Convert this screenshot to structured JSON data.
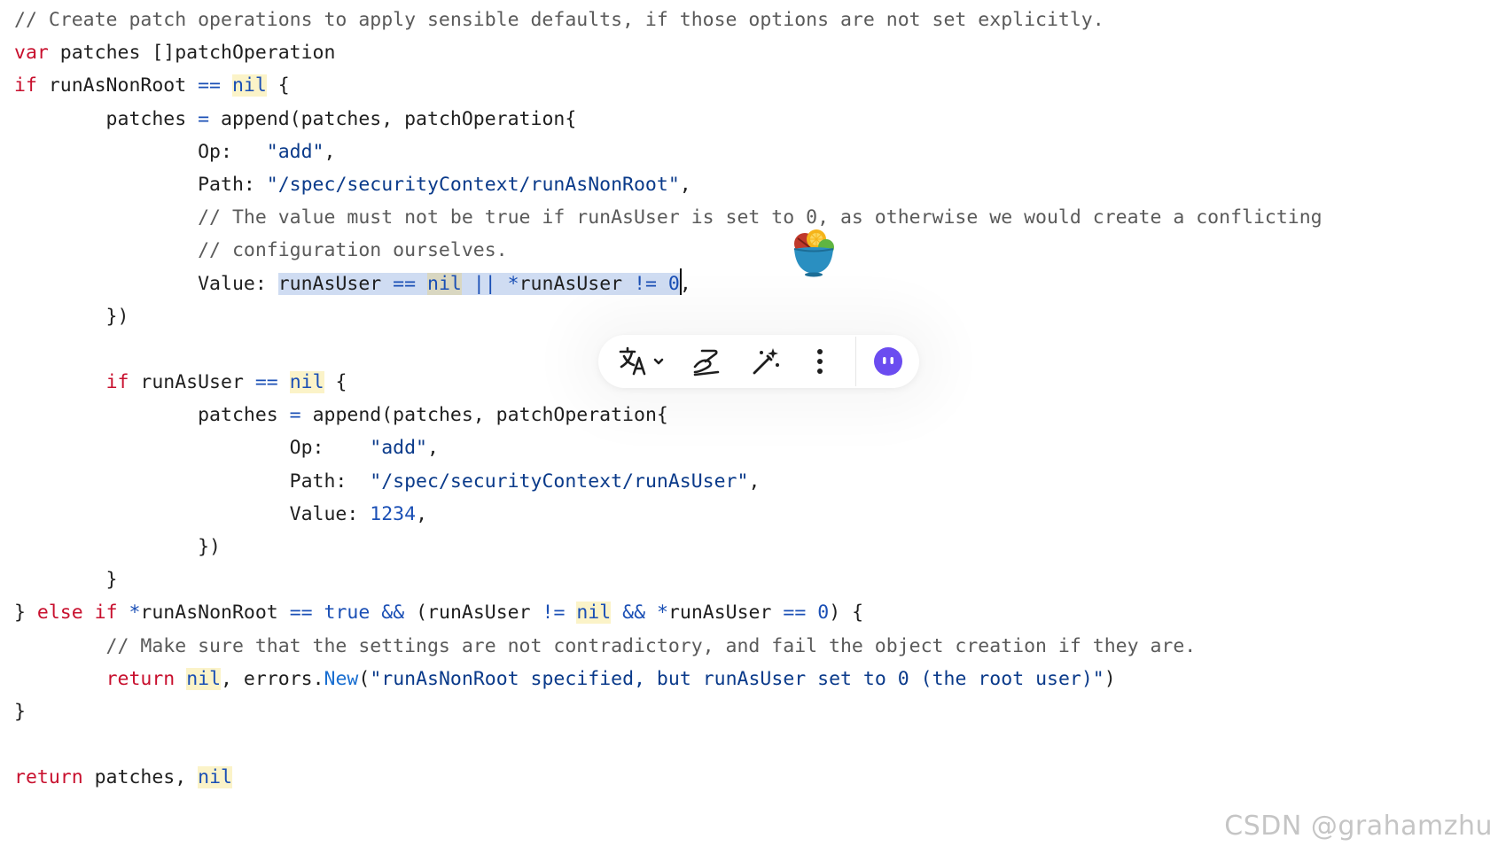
{
  "editor": {
    "lines": [
      [
        {
          "t": "// Create patch operations to apply sensible defaults, if those options are not set explicitly.",
          "c": "cm"
        }
      ],
      [
        {
          "t": "var",
          "c": "kw"
        },
        {
          "t": " patches []patchOperation"
        }
      ],
      [
        {
          "t": "if",
          "c": "kw"
        },
        {
          "t": " runAsNonRoot "
        },
        {
          "t": "==",
          "c": "op"
        },
        {
          "t": " "
        },
        {
          "t": "nil",
          "c": "nil"
        },
        {
          "t": " {"
        }
      ],
      [
        {
          "t": "        patches "
        },
        {
          "t": "=",
          "c": "op"
        },
        {
          "t": " append(patches, patchOperation{"
        }
      ],
      [
        {
          "t": "                Op:   "
        },
        {
          "t": "\"add\"",
          "c": "st"
        },
        {
          "t": ","
        }
      ],
      [
        {
          "t": "                Path: "
        },
        {
          "t": "\"/spec/securityContext/runAsNonRoot\"",
          "c": "st"
        },
        {
          "t": ","
        }
      ],
      [
        {
          "t": "                // The value must not be true if runAsUser is set to 0, as otherwise we would create a conflicting",
          "c": "cm"
        }
      ],
      [
        {
          "t": "                // configuration ourselves.",
          "c": "cm"
        }
      ],
      [
        {
          "t": "                Value: "
        },
        {
          "t": "runAsUser ",
          "s": 1
        },
        {
          "t": "==",
          "c": "op",
          "s": 1
        },
        {
          "t": " ",
          "s": 1
        },
        {
          "t": "nil",
          "c": "nil",
          "s": 1
        },
        {
          "t": " ",
          "s": 1
        },
        {
          "t": "||",
          "c": "op",
          "s": 1
        },
        {
          "t": " ",
          "s": 1
        },
        {
          "t": "*",
          "c": "op",
          "s": 1
        },
        {
          "t": "runAsUser ",
          "s": 1
        },
        {
          "t": "!=",
          "c": "op",
          "s": 1
        },
        {
          "t": " ",
          "s": 1
        },
        {
          "t": "0",
          "c": "nm",
          "s": 1
        },
        {
          "caret": 1
        },
        {
          "t": ","
        }
      ],
      [
        {
          "t": "        })"
        }
      ],
      [
        {
          "t": ""
        }
      ],
      [
        {
          "t": "        "
        },
        {
          "t": "if",
          "c": "kw"
        },
        {
          "t": " runAsUser "
        },
        {
          "t": "==",
          "c": "op"
        },
        {
          "t": " "
        },
        {
          "t": "nil",
          "c": "nil"
        },
        {
          "t": " {"
        }
      ],
      [
        {
          "t": "                patches "
        },
        {
          "t": "=",
          "c": "op"
        },
        {
          "t": " append(patches, patchOperation{"
        }
      ],
      [
        {
          "t": "                        Op:    "
        },
        {
          "t": "\"add\"",
          "c": "st"
        },
        {
          "t": ","
        }
      ],
      [
        {
          "t": "                        Path:  "
        },
        {
          "t": "\"/spec/securityContext/runAsUser\"",
          "c": "st"
        },
        {
          "t": ","
        }
      ],
      [
        {
          "t": "                        Value: "
        },
        {
          "t": "1234",
          "c": "nm"
        },
        {
          "t": ","
        }
      ],
      [
        {
          "t": "                })"
        }
      ],
      [
        {
          "t": "        }"
        }
      ],
      [
        {
          "t": "} "
        },
        {
          "t": "else",
          "c": "kw"
        },
        {
          "t": " "
        },
        {
          "t": "if",
          "c": "kw"
        },
        {
          "t": " "
        },
        {
          "t": "*",
          "c": "op"
        },
        {
          "t": "runAsNonRoot "
        },
        {
          "t": "==",
          "c": "op"
        },
        {
          "t": " "
        },
        {
          "t": "true",
          "c": "nm"
        },
        {
          "t": " "
        },
        {
          "t": "&&",
          "c": "op"
        },
        {
          "t": " (runAsUser "
        },
        {
          "t": "!=",
          "c": "op"
        },
        {
          "t": " "
        },
        {
          "t": "nil",
          "c": "nil"
        },
        {
          "t": " "
        },
        {
          "t": "&&",
          "c": "op"
        },
        {
          "t": " "
        },
        {
          "t": "*",
          "c": "op"
        },
        {
          "t": "runAsUser "
        },
        {
          "t": "==",
          "c": "op"
        },
        {
          "t": " "
        },
        {
          "t": "0",
          "c": "nm"
        },
        {
          "t": ") {"
        }
      ],
      [
        {
          "t": "        // Make sure that the settings are not contradictory, and fail the object creation if they are.",
          "c": "cm"
        }
      ],
      [
        {
          "t": "        "
        },
        {
          "t": "return",
          "c": "kw"
        },
        {
          "t": " "
        },
        {
          "t": "nil",
          "c": "nil"
        },
        {
          "t": ", errors."
        },
        {
          "t": "New",
          "c": "fn"
        },
        {
          "t": "("
        },
        {
          "t": "\"runAsNonRoot specified, but runAsUser set to 0 (the root user)\"",
          "c": "st"
        },
        {
          "t": ")"
        }
      ],
      [
        {
          "t": "}"
        }
      ],
      [
        {
          "t": ""
        }
      ],
      [
        {
          "t": "return",
          "c": "kw"
        },
        {
          "t": " patches, "
        },
        {
          "t": "nil",
          "c": "nil"
        }
      ]
    ]
  },
  "toolbar": {
    "items": [
      {
        "name": "translate-button",
        "icon": "translate-icon",
        "has_dropdown": true
      },
      {
        "name": "annotate-button",
        "icon": "signature-pen-icon"
      },
      {
        "name": "ai-magic-button",
        "icon": "magic-wand-icon"
      },
      {
        "name": "more-options-button",
        "icon": "vertical-ellipsis-icon"
      },
      {
        "name": "assistant-button",
        "icon": "assistant-face-icon"
      }
    ],
    "accent_color": "#6b4cf0"
  },
  "sticker": {
    "icon": "fruit-bowl-icon"
  },
  "watermark": {
    "text": "CSDN @grahamzhu"
  },
  "colors": {
    "keyword": "#c8102e",
    "comment": "#5a5a5a",
    "string": "#0a3a8a",
    "operator": "#1a4fb5",
    "nil_highlight": "#fbf3c8",
    "selection": "#cfdcf2"
  }
}
